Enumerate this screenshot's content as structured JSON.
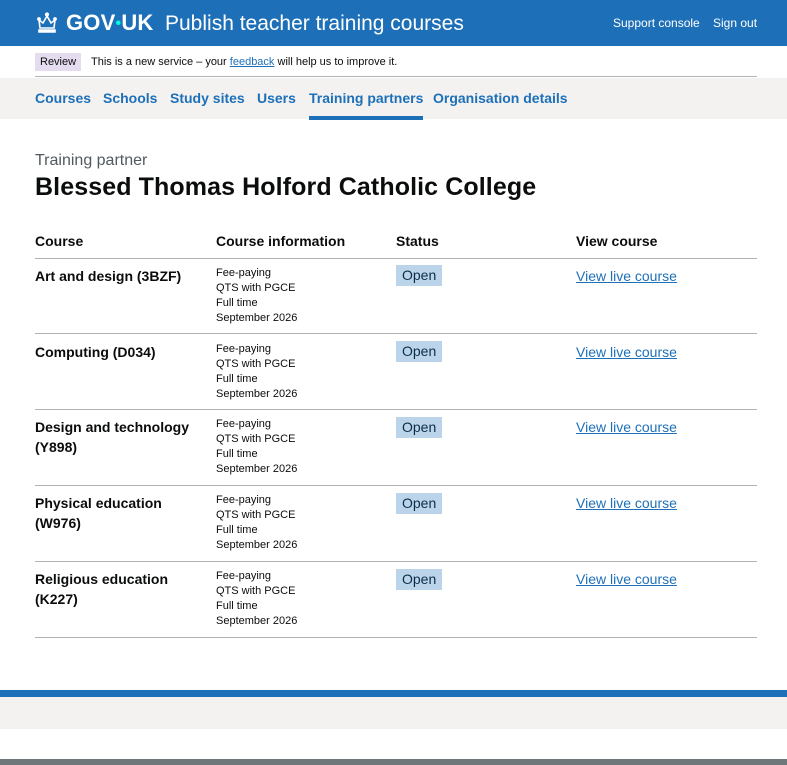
{
  "header": {
    "brand_main": "GOV",
    "brand_dot": "•",
    "brand_end": "UK",
    "service_name": "Publish teacher training courses",
    "links": {
      "support": "Support console",
      "signout": "Sign out"
    },
    "colors": {
      "background": "#1d70b8"
    }
  },
  "phase_banner": {
    "tag": "Review",
    "text_before": "This is a new service – your",
    "link": "feedback",
    "text_after": "will help us to improve it."
  },
  "nav": {
    "items": [
      "Courses",
      "Schools",
      "Study sites",
      "Users",
      "Training partners",
      "Organisation details"
    ],
    "active": "Training partners"
  },
  "page": {
    "caption": "Training partner",
    "title": "Blessed Thomas Holford Catholic College"
  },
  "table": {
    "headers": [
      "Course",
      "Course information",
      "Status",
      "View course"
    ],
    "rows": [
      {
        "name_line1": "Art and design (3BZF)",
        "name_line2": "",
        "info": [
          "Fee-paying",
          "QTS with PGCE",
          "Full time",
          "September 2026"
        ],
        "status": "Open",
        "link": "View live course"
      },
      {
        "name_line1": "Computing (D034)",
        "name_line2": "",
        "info": [
          "Fee-paying",
          "QTS with PGCE",
          "Full time",
          "September 2026"
        ],
        "status": "Open",
        "link": "View live course"
      },
      {
        "name_line1": "Design and technology",
        "name_line2": "(Y898)",
        "info": [
          "Fee-paying",
          "QTS with PGCE",
          "Full time",
          "September 2026"
        ],
        "status": "Open",
        "link": "View live course"
      },
      {
        "name_line1": "Physical education",
        "name_line2": "(W976)",
        "info": [
          "Fee-paying",
          "QTS with PGCE",
          "Full time",
          "September 2026"
        ],
        "status": "Open",
        "link": "View live course"
      },
      {
        "name_line1": "Religious education",
        "name_line2": "(K227)",
        "info": [
          "Fee-paying",
          "QTS with PGCE",
          "Full time",
          "September 2026"
        ],
        "status": "Open",
        "link": "View live course"
      }
    ],
    "colors": {
      "status_tag": "#bbd4ea",
      "link": "#1d70b8"
    }
  }
}
